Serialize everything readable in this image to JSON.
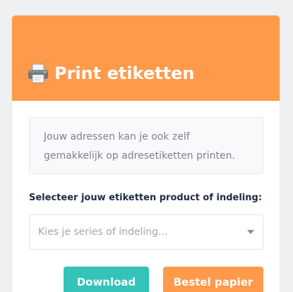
{
  "card": {
    "title": "Print etiketten",
    "icon": "printer-icon",
    "info_text": "Jouw adressen kan je ook zelf gemakkelijk op adresetiketten printen.",
    "select_label": "Selecteer jouw etiketten product of indeling:",
    "select_placeholder": "Kies je series of indeling...",
    "download_label": "Download",
    "order_label": "Bestel papier"
  },
  "colors": {
    "header": "#ff9a4b",
    "download": "#34c3b8",
    "order": "#ff9a4b"
  }
}
